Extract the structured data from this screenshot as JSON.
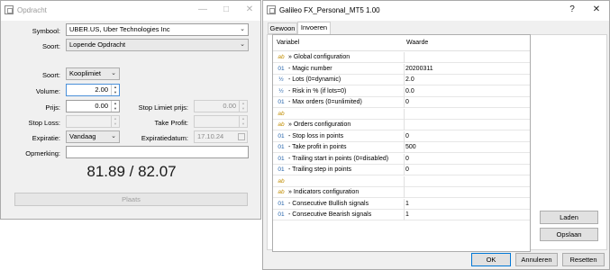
{
  "order_window": {
    "title": "Opdracht",
    "symbol_label": "Symbool:",
    "symbol_value": "UBER.US, Uber Technologies Inc",
    "type_label": "Soort:",
    "type_value": "Lopende Opdracht",
    "order_type_label": "Soort:",
    "order_type_value": "Kooplimiet",
    "volume_label": "Volume:",
    "volume_value": "2.00",
    "price_label": "Prijs:",
    "price_value": "0.00",
    "stop_limit_label": "Stop Limiet prijs:",
    "stop_limit_value": "0.00",
    "stop_loss_label": "Stop Loss:",
    "take_profit_label": "Take Profit:",
    "expiration_label": "Expiratie:",
    "expiration_value": "Vandaag",
    "expiration_date_label": "Expiratiedatum:",
    "expiration_date_value": "17.10.24",
    "comment_label": "Opmerking:",
    "bid_ask": "81.89 / 82.07",
    "place_button": "Plaats"
  },
  "ea_window": {
    "title": "Galileo FX_Personal_MT5 1.00",
    "tabs": [
      "Gewoon",
      "Invoeren"
    ],
    "columns": [
      "Variabel",
      "Waarde"
    ],
    "rows": [
      {
        "icon": "ab",
        "name": "» Global configuration",
        "value": ""
      },
      {
        "icon": "01",
        "name": "- Magic number",
        "value": "20200311"
      },
      {
        "icon": "½",
        "name": "- Lots (0=dynamic)",
        "value": "2.0"
      },
      {
        "icon": "½",
        "name": "- Risk in % (if lots=0)",
        "value": "0.0"
      },
      {
        "icon": "01",
        "name": "- Max orders (0=unlimited)",
        "value": "0"
      },
      {
        "icon": "ab",
        "name": "",
        "value": ""
      },
      {
        "icon": "ab",
        "name": "» Orders configuration",
        "value": ""
      },
      {
        "icon": "01",
        "name": "- Stop loss in points",
        "value": "0"
      },
      {
        "icon": "01",
        "name": "- Take profit in points",
        "value": "500"
      },
      {
        "icon": "01",
        "name": "- Trailing start in points (0=disabled)",
        "value": "0"
      },
      {
        "icon": "01",
        "name": "- Trailing step in points",
        "value": "0"
      },
      {
        "icon": "ab",
        "name": "",
        "value": ""
      },
      {
        "icon": "ab",
        "name": "» Indicators configuration",
        "value": ""
      },
      {
        "icon": "01",
        "name": "- Consecutive Bullish signals",
        "value": "1"
      },
      {
        "icon": "01",
        "name": "- Consecutive Bearish signals",
        "value": "1"
      }
    ],
    "load_button": "Laden",
    "save_button": "Opslaan",
    "ok_button": "OK",
    "cancel_button": "Annuleren",
    "reset_button": "Resetten"
  }
}
